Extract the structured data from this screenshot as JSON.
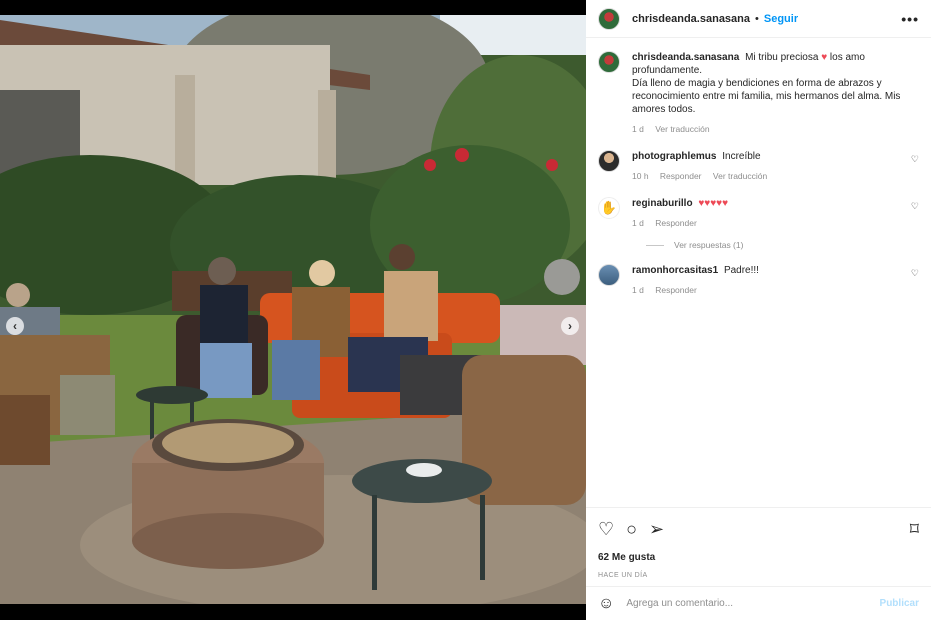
{
  "post": {
    "username": "chrisdeanda.sanasana",
    "follow_label": "Seguir",
    "more_label": "•••",
    "caption_line1": "Mi tribu preciosa",
    "caption_heart": "♥",
    "caption_line1_end": "los amo profundamente.",
    "caption_line2": "Día lleno de magia y bendiciones en forma de abrazos y reconocimiento entre mi familia, mis hermanos del alma. Mis amores todos.",
    "caption_time": "1 d",
    "caption_translate": "Ver traducción"
  },
  "comments": [
    {
      "user": "photographlemus",
      "text": "Increíble",
      "time": "10 h",
      "reply": "Responder",
      "translate": "Ver traducción"
    },
    {
      "user": "reginaburillo",
      "text": "♥♥♥♥♥",
      "time": "1 d",
      "reply": "Responder",
      "icon": "✋"
    },
    {
      "user": "ramonhorcasitas1",
      "text": "Padre!!!",
      "time": "1 d",
      "reply": "Responder"
    }
  ],
  "replies_label": "Ver respuestas (1)",
  "actions": {
    "likes": "62 Me gusta",
    "date": "HACE UN DÍA",
    "heart_icon": "♡",
    "comment_icon": "○",
    "share_icon": "➢",
    "bookmark_icon": "⌑"
  },
  "composer": {
    "emoji_icon": "☺",
    "placeholder": "Agrega un comentario...",
    "publish_label": "Publicar"
  },
  "photo": {
    "prev_arrow": "‹",
    "next_arrow": "›"
  }
}
